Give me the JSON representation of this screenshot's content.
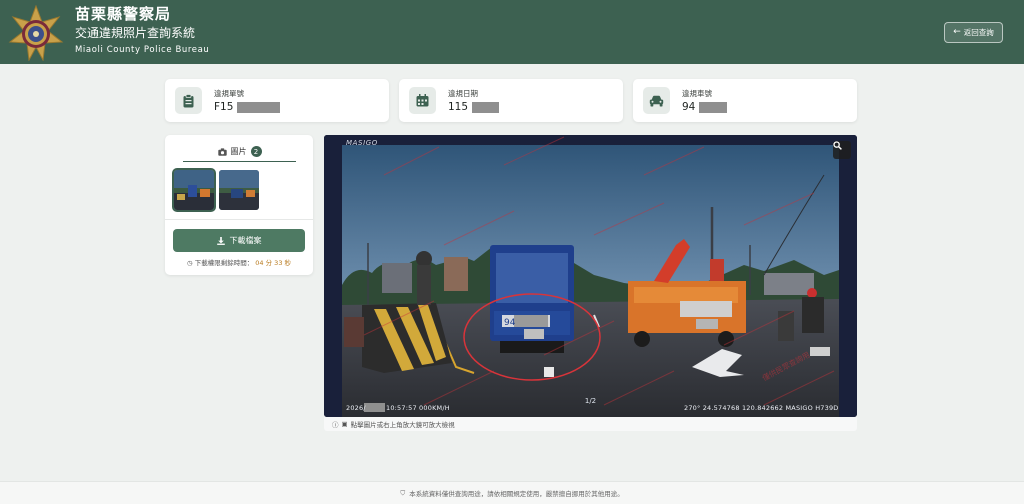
{
  "header": {
    "title": "苗栗縣警察局",
    "subtitle": "交通違規照片查詢系統",
    "title_en": "Miaoli County Police Bureau",
    "back_label": "返回查詢",
    "brand_color": "#3d6151"
  },
  "cards": [
    {
      "label": "違規單號",
      "value": "F15",
      "icon": "clipboard-icon"
    },
    {
      "label": "違規日期",
      "value": "115",
      "icon": "calendar-icon"
    },
    {
      "label": "違規車號",
      "value": "94",
      "icon": "car-icon"
    }
  ],
  "gallery": {
    "tab_label": "圖片",
    "count": "2",
    "download_label": "下載檔案",
    "countdown_label": "下載權限剩餘時間：",
    "countdown_time": "04 分 33 秒"
  },
  "viewer": {
    "camera_brand": "MASIGO",
    "osd_left": "2026/",
    "osd_time": "10:57:57 000KM/H",
    "osd_right": "270°  24.574768  120.842662  MASIGO H739D",
    "page_indicator": "1/2",
    "plate_fragment": "94",
    "watermark": "僅供民眾查詢用",
    "caption": "點擊圖片或右上角放大鏡可放大檢視"
  },
  "footer": {
    "notice": "本系統資料僅供查詢用途，請依相關規定使用，嚴禁擅自挪用於其他用途。"
  }
}
